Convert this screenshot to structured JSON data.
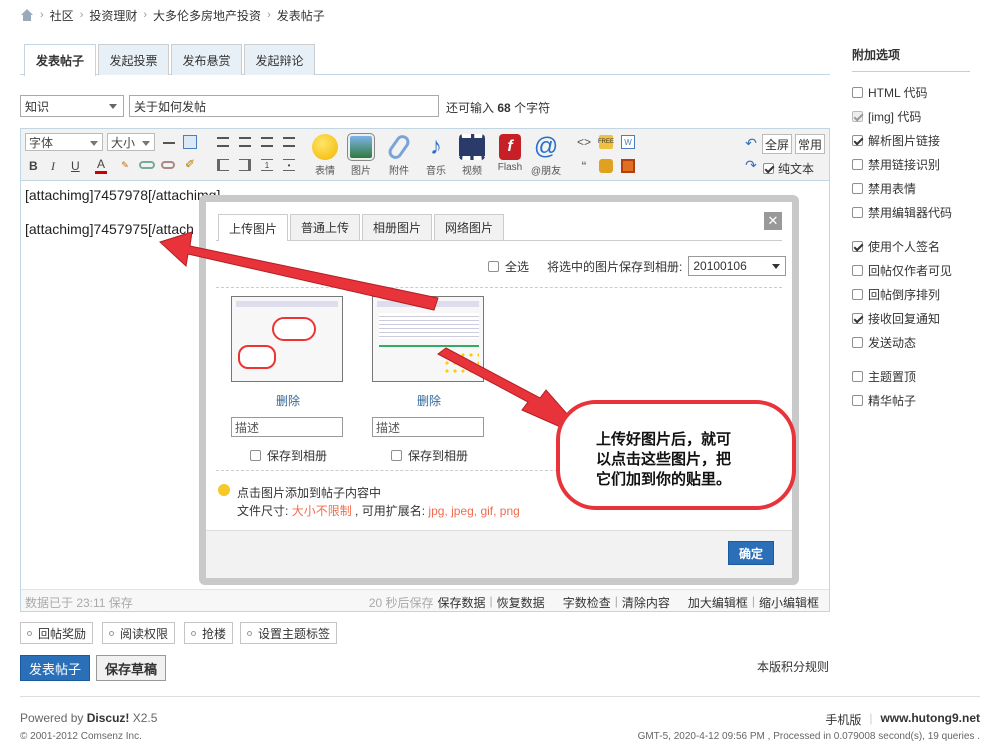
{
  "breadcrumb": [
    "社区",
    "投资理财",
    "大多伦多房地产投资",
    "发表帖子"
  ],
  "tabs": [
    "发表帖子",
    "发起投票",
    "发布悬赏",
    "发起辩论"
  ],
  "subject": {
    "category": "知识",
    "title": "关于如何发帖",
    "remaining_prefix": "还可输入",
    "remaining_count": "68",
    "remaining_suffix": "个字符"
  },
  "toolbar": {
    "font": "字体",
    "size": "大小",
    "big_buttons": [
      "表情",
      "图片",
      "附件",
      "音乐",
      "视频",
      "Flash",
      "@朋友"
    ],
    "fullscreen": "全屏",
    "common": "常用",
    "plaintext": "纯文本"
  },
  "editor_lines": [
    "[attachimg]7457978[/attachimg]",
    "[attachimg]7457975[/attach"
  ],
  "status": {
    "saved": "数据已于 23:11 保存",
    "links": [
      "20 秒后保存",
      "保存数据",
      "恢复数据",
      "字数检查",
      "清除内容",
      "加大编辑框",
      "缩小编辑框"
    ]
  },
  "dialog": {
    "tabs": [
      "上传图片",
      "普通上传",
      "相册图片",
      "网络图片"
    ],
    "select_all": "全选",
    "save_to_album": "将选中的图片保存到相册:",
    "album": "20100106",
    "items": [
      {
        "delete": "删除",
        "desc": "描述",
        "save": "保存到相册"
      },
      {
        "delete": "删除",
        "desc": "描述",
        "save": "保存到相册"
      }
    ],
    "hint": "点击图片添加到帖子内容中",
    "size_label": "文件尺寸:",
    "size_value": "大小不限制",
    "ext_label": ", 可用扩展名:",
    "ext_value": "jpg, jpeg, gif, png",
    "confirm": "确定"
  },
  "callout": {
    "lines": [
      "上传好图片后，就可",
      "以点击这些图片，把",
      "它们加到你的贴里。"
    ]
  },
  "sidebar": {
    "title": "附加选项",
    "group1": [
      {
        "label": "HTML 代码",
        "checked": false
      },
      {
        "label": "[img] 代码",
        "checked": true,
        "disabled": true
      },
      {
        "label": "解析图片链接",
        "checked": true
      },
      {
        "label": "禁用链接识别",
        "checked": false
      },
      {
        "label": "禁用表情",
        "checked": false
      },
      {
        "label": "禁用编辑器代码",
        "checked": false
      }
    ],
    "group2": [
      {
        "label": "使用个人签名",
        "checked": true
      },
      {
        "label": "回帖仅作者可见",
        "checked": false
      },
      {
        "label": "回帖倒序排列",
        "checked": false
      },
      {
        "label": "接收回复通知",
        "checked": true
      },
      {
        "label": "发送动态",
        "checked": false
      }
    ],
    "group3": [
      {
        "label": "主题置顶",
        "checked": false
      },
      {
        "label": "精华帖子",
        "checked": false
      }
    ]
  },
  "extras": [
    "回帖奖励",
    "阅读权限",
    "抢楼",
    "设置主题标签"
  ],
  "actions": {
    "post": "发表帖子",
    "draft": "保存草稿",
    "rules": "本版积分规则"
  },
  "footer": {
    "powered": "Powered by",
    "product": "Discuz!",
    "version": "X2.5",
    "copyright": "© 2001-2012 Comsenz Inc.",
    "mobile": "手机版",
    "site": "www.hutong9.net",
    "stats": "GMT-5, 2020-4-12 09:56 PM , Processed in 0.079008 second(s), 19 queries ."
  },
  "colors": {
    "accent": "#336699",
    "button_blue": "#2a6fb8",
    "arrow_red": "#e8333a",
    "link_red": "#f26c4f"
  }
}
